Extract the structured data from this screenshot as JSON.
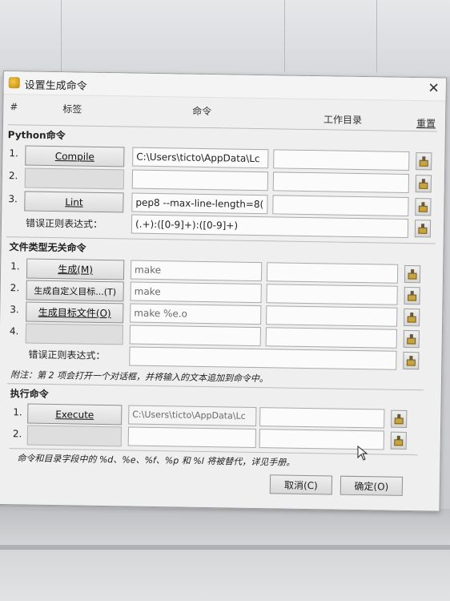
{
  "dialog": {
    "title": "设置生成命令",
    "close_glyph": "✕"
  },
  "headers": {
    "num": "#",
    "label": "标签",
    "command": "命令",
    "workdir": "工作目录",
    "reset": "重置"
  },
  "python": {
    "title": "Python命令",
    "rows": [
      {
        "num": "1.",
        "label": "Compile",
        "command": "C:\\Users\\ticto\\AppData\\Lc",
        "workdir": ""
      },
      {
        "num": "2.",
        "label": "",
        "command": "",
        "workdir": ""
      },
      {
        "num": "3.",
        "label": "Lint",
        "command": "pep8 --max-line-length=8(",
        "workdir": ""
      }
    ],
    "regex_label": "错误正则表达式：",
    "regex_value": "(.+):([0-9]+):([0-9]+)"
  },
  "filetype_independent": {
    "title": "文件类型无关命令",
    "rows": [
      {
        "num": "1.",
        "label": "生成(M)",
        "command": "make",
        "workdir": ""
      },
      {
        "num": "2.",
        "label": "生成自定义目标...(T)",
        "command": "make",
        "workdir": ""
      },
      {
        "num": "3.",
        "label": "生成目标文件(O)",
        "command": "make %e.o",
        "workdir": ""
      },
      {
        "num": "4.",
        "label": "",
        "command": "",
        "workdir": ""
      }
    ],
    "regex_label": "错误正则表达式：",
    "regex_value": "",
    "note": "附注：第 2 项会打开一个对话框，并将输入的文本追加到命令中。"
  },
  "execute": {
    "title": "执行命令",
    "rows": [
      {
        "num": "1.",
        "label": "Execute",
        "command": "C:\\Users\\ticto\\AppData\\Lc",
        "workdir": ""
      },
      {
        "num": "2.",
        "label": "",
        "command": "",
        "workdir": ""
      }
    ]
  },
  "footer_note": "命令和目录字段中的 %d、%e、%f、%p 和 %l 将被替代，详见手册。",
  "buttons": {
    "cancel": "取消(C)",
    "ok": "确定(O)"
  },
  "icons": {
    "app": "geany-icon",
    "reset": "clear-broom-icon",
    "cursor": "mouse-pointer-icon"
  }
}
